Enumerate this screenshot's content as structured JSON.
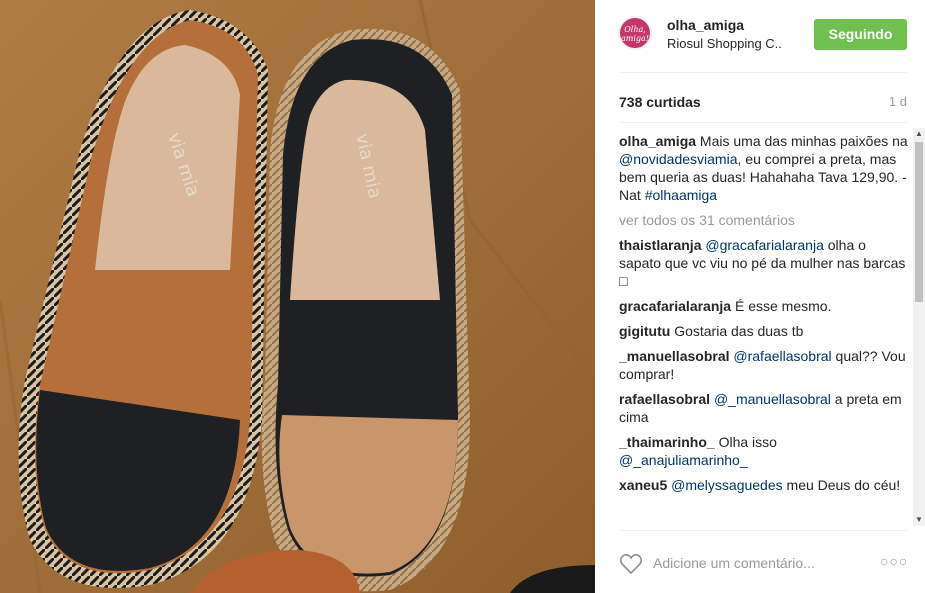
{
  "photo": {
    "brand_text": "via mia",
    "colors": {
      "table": "#a5743b",
      "tan_leather": "#b56f3a",
      "black_leather": "#1e2024",
      "nude_leather": "#c9956a",
      "insole": "#d9b89c",
      "jute": "#c9a77f"
    }
  },
  "header": {
    "avatar_text": "Olha, amiga!",
    "username": "olha_amiga",
    "location": "Riosul Shopping C..",
    "follow_label": "Seguindo"
  },
  "stats": {
    "likes": "738 curtidas",
    "time": "1 d"
  },
  "caption": {
    "author": "olha_amiga",
    "text_1": " Mais uma das minhas paixões na ",
    "mention": "@novidadesviamia",
    "text_2": ", eu comprei a preta, mas bem queria as duas! Hahahaha Tava 129,90. - Nat ",
    "hashtag": "#olhaamiga"
  },
  "view_all": "ver todos os 31 comentários",
  "comments": [
    {
      "author": "thaistlaranja",
      "mention": "@gracafarialaranja",
      "text": " olha o sapato que vc viu no pé da mulher nas barcas □"
    },
    {
      "author": "gracafarialaranja",
      "mention": "",
      "text": " É esse mesmo."
    },
    {
      "author": "gigitutu",
      "mention": "",
      "text": " Gostaria das duas tb"
    },
    {
      "author": "_manuellasobral",
      "mention": "@rafaellasobral",
      "text": " qual?? Vou comprar!"
    },
    {
      "author": "rafaellasobral",
      "mention": "@_manuellasobral",
      "text": " a preta em cima"
    },
    {
      "author": "_thaimarinho_",
      "mention": "",
      "text": " Olha isso ",
      "mention_after": "@_anajuliamarinho_"
    },
    {
      "author": "xaneu5",
      "mention": "@melyssaguedes",
      "text": " meu Deus do céu!"
    }
  ],
  "footer": {
    "comment_placeholder": "Adicione um comentário...",
    "more_label": "○○○"
  },
  "icons": {
    "heart": "heart-icon",
    "more": "more-options-icon",
    "scroll_up": "▲",
    "scroll_down": "▼"
  }
}
